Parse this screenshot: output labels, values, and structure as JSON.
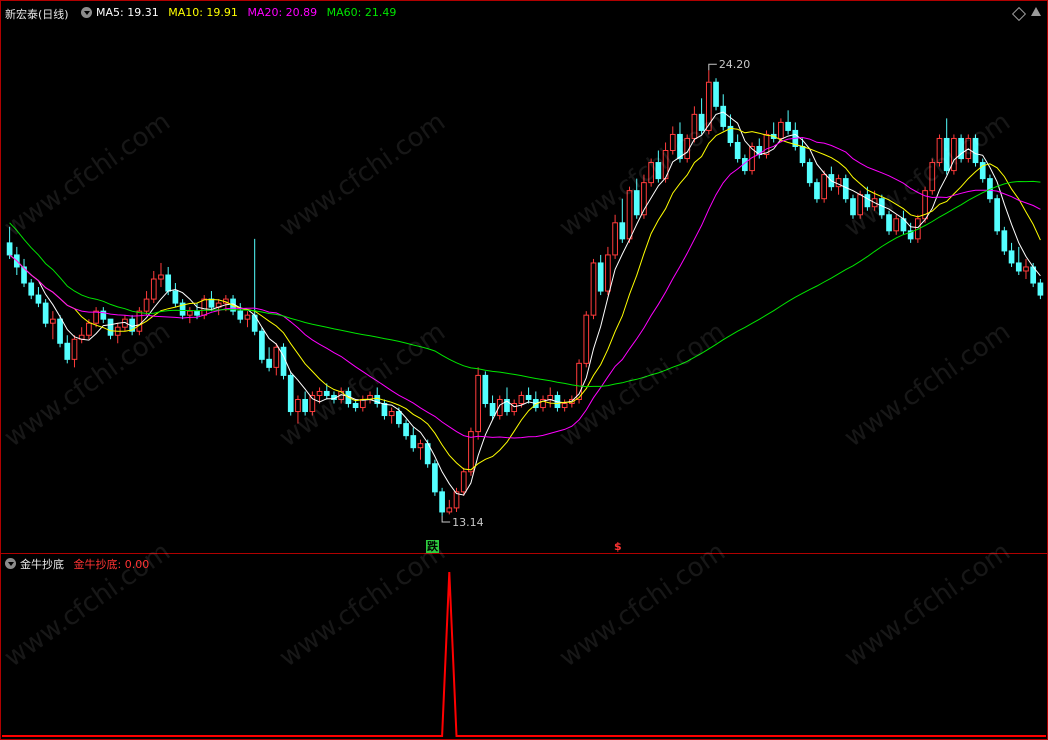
{
  "header": {
    "stock_title": "新宏泰(日线)",
    "ma5_label": "MA5: 19.31",
    "ma10_label": "MA10: 19.91",
    "ma20_label": "MA20: 20.89",
    "ma60_label": "MA60: 21.49"
  },
  "indicator_header": {
    "title": "金牛抄底",
    "value_label": "金牛抄底: 0.00"
  },
  "signals": {
    "down": "跌",
    "dollar": "$"
  },
  "annotations": {
    "high": "24.20",
    "low": "13.14"
  },
  "watermark": "www.cfchi.com",
  "colors": {
    "up": "#ff3c3c",
    "down": "#54ffff",
    "ma5": "#ffffff",
    "ma10": "#ffff00",
    "ma20": "#ff00ff",
    "ma60": "#00e600",
    "border": "#b00000",
    "indicator": "#ff0000"
  },
  "chart_data": [
    {
      "type": "candlestick",
      "title": "新宏泰(日线)",
      "ylim": [
        12.8,
        25.4
      ],
      "ohlc": [
        [
          19.9,
          20.3,
          19.5,
          19.6
        ],
        [
          19.6,
          19.8,
          19.1,
          19.3
        ],
        [
          19.3,
          19.5,
          18.8,
          18.9
        ],
        [
          18.9,
          19.0,
          18.5,
          18.6
        ],
        [
          18.6,
          18.8,
          18.3,
          18.4
        ],
        [
          18.4,
          18.5,
          17.8,
          17.9
        ],
        [
          17.9,
          18.2,
          17.5,
          18.0
        ],
        [
          18.0,
          18.1,
          17.3,
          17.4
        ],
        [
          17.4,
          17.6,
          16.9,
          17.0
        ],
        [
          17.0,
          17.6,
          16.8,
          17.5
        ],
        [
          17.5,
          17.8,
          17.4,
          17.6
        ],
        [
          17.6,
          18.0,
          17.5,
          17.9
        ],
        [
          17.9,
          18.3,
          17.8,
          18.2
        ],
        [
          18.2,
          18.3,
          17.9,
          18.0
        ],
        [
          18.0,
          18.0,
          17.5,
          17.6
        ],
        [
          17.6,
          17.9,
          17.4,
          17.8
        ],
        [
          17.8,
          18.1,
          17.7,
          18.0
        ],
        [
          18.0,
          18.1,
          17.6,
          17.7
        ],
        [
          17.7,
          18.3,
          17.6,
          18.2
        ],
        [
          18.2,
          18.7,
          18.1,
          18.5
        ],
        [
          18.5,
          19.2,
          18.4,
          19.0
        ],
        [
          19.0,
          19.4,
          18.8,
          19.1
        ],
        [
          19.1,
          19.3,
          18.6,
          18.7
        ],
        [
          18.7,
          18.9,
          18.3,
          18.4
        ],
        [
          18.4,
          18.5,
          18.0,
          18.1
        ],
        [
          18.1,
          18.3,
          17.9,
          18.2
        ],
        [
          18.2,
          18.4,
          18.0,
          18.1
        ],
        [
          18.1,
          18.6,
          18.0,
          18.5
        ],
        [
          18.5,
          18.7,
          18.2,
          18.3
        ],
        [
          18.3,
          18.5,
          18.1,
          18.4
        ],
        [
          18.4,
          18.6,
          18.2,
          18.5
        ],
        [
          18.5,
          18.6,
          18.1,
          18.2
        ],
        [
          18.2,
          18.4,
          17.9,
          18.0
        ],
        [
          18.0,
          18.2,
          17.8,
          18.1
        ],
        [
          18.1,
          20.0,
          17.6,
          17.7
        ],
        [
          17.7,
          17.8,
          16.9,
          17.0
        ],
        [
          17.0,
          17.3,
          16.7,
          16.8
        ],
        [
          16.8,
          17.4,
          16.6,
          17.3
        ],
        [
          17.3,
          17.4,
          16.5,
          16.6
        ],
        [
          16.6,
          16.7,
          15.6,
          15.7
        ],
        [
          15.7,
          16.1,
          15.4,
          16.0
        ],
        [
          16.0,
          16.2,
          15.6,
          15.7
        ],
        [
          15.7,
          16.2,
          15.6,
          16.1
        ],
        [
          16.1,
          16.3,
          15.9,
          16.2
        ],
        [
          16.2,
          16.4,
          16.0,
          16.1
        ],
        [
          16.1,
          16.2,
          15.9,
          16.0
        ],
        [
          16.0,
          16.3,
          15.9,
          16.2
        ],
        [
          16.2,
          16.3,
          15.8,
          15.9
        ],
        [
          15.9,
          16.0,
          15.7,
          15.8
        ],
        [
          15.8,
          16.1,
          15.7,
          16.0
        ],
        [
          16.0,
          16.2,
          15.9,
          16.1
        ],
        [
          16.1,
          16.3,
          15.8,
          15.9
        ],
        [
          15.9,
          16.0,
          15.5,
          15.6
        ],
        [
          15.6,
          15.8,
          15.4,
          15.7
        ],
        [
          15.7,
          15.8,
          15.3,
          15.4
        ],
        [
          15.4,
          15.5,
          15.0,
          15.1
        ],
        [
          15.1,
          15.3,
          14.7,
          14.8
        ],
        [
          14.8,
          15.0,
          14.5,
          14.9
        ],
        [
          14.9,
          15.0,
          14.3,
          14.4
        ],
        [
          14.4,
          14.5,
          13.6,
          13.7
        ],
        [
          13.7,
          13.8,
          13.1,
          13.2
        ],
        [
          13.2,
          13.5,
          13.14,
          13.3
        ],
        [
          13.3,
          13.8,
          13.2,
          13.7
        ],
        [
          13.7,
          14.3,
          13.6,
          14.2
        ],
        [
          14.2,
          15.3,
          14.1,
          15.2
        ],
        [
          15.2,
          16.8,
          15.0,
          16.6
        ],
        [
          16.6,
          16.7,
          15.8,
          15.9
        ],
        [
          15.9,
          16.1,
          15.5,
          15.6
        ],
        [
          15.6,
          16.1,
          15.5,
          16.0
        ],
        [
          16.0,
          16.3,
          15.6,
          15.7
        ],
        [
          15.7,
          16.0,
          15.6,
          15.9
        ],
        [
          15.9,
          16.2,
          15.8,
          16.1
        ],
        [
          16.1,
          16.3,
          15.9,
          16.0
        ],
        [
          16.0,
          16.2,
          15.7,
          15.8
        ],
        [
          15.8,
          16.1,
          15.7,
          16.0
        ],
        [
          16.0,
          16.3,
          15.8,
          16.1
        ],
        [
          16.1,
          16.2,
          15.7,
          15.8
        ],
        [
          15.8,
          16.0,
          15.7,
          15.9
        ],
        [
          15.9,
          16.1,
          15.8,
          16.0
        ],
        [
          16.0,
          17.0,
          15.9,
          16.9
        ],
        [
          16.9,
          18.2,
          16.8,
          18.1
        ],
        [
          18.1,
          19.5,
          18.0,
          19.4
        ],
        [
          19.4,
          19.6,
          18.6,
          18.7
        ],
        [
          18.7,
          19.8,
          18.6,
          19.6
        ],
        [
          19.6,
          20.6,
          19.5,
          20.4
        ],
        [
          20.4,
          21.0,
          19.9,
          20.0
        ],
        [
          20.0,
          21.3,
          19.9,
          21.2
        ],
        [
          21.2,
          21.5,
          20.5,
          20.6
        ],
        [
          20.6,
          21.6,
          20.5,
          21.4
        ],
        [
          21.4,
          22.0,
          21.3,
          21.9
        ],
        [
          21.9,
          22.2,
          21.4,
          21.5
        ],
        [
          21.5,
          22.4,
          21.4,
          22.2
        ],
        [
          22.2,
          22.8,
          22.1,
          22.6
        ],
        [
          22.6,
          22.9,
          21.9,
          22.0
        ],
        [
          22.0,
          22.6,
          21.9,
          22.5
        ],
        [
          22.5,
          23.3,
          22.4,
          23.1
        ],
        [
          23.1,
          23.5,
          22.6,
          22.7
        ],
        [
          22.7,
          24.2,
          22.6,
          23.9
        ],
        [
          23.9,
          24.0,
          23.2,
          23.3
        ],
        [
          23.3,
          23.6,
          22.7,
          22.8
        ],
        [
          22.8,
          23.1,
          22.3,
          22.4
        ],
        [
          22.4,
          22.6,
          21.9,
          22.0
        ],
        [
          22.0,
          22.1,
          21.6,
          21.7
        ],
        [
          21.7,
          22.4,
          21.6,
          22.3
        ],
        [
          22.3,
          22.5,
          22.0,
          22.1
        ],
        [
          22.1,
          22.7,
          22.0,
          22.6
        ],
        [
          22.6,
          22.9,
          22.4,
          22.5
        ],
        [
          22.5,
          23.0,
          22.4,
          22.9
        ],
        [
          22.9,
          23.2,
          22.6,
          22.7
        ],
        [
          22.7,
          22.9,
          22.2,
          22.3
        ],
        [
          22.3,
          22.5,
          21.8,
          21.9
        ],
        [
          21.9,
          22.0,
          21.3,
          21.4
        ],
        [
          21.4,
          21.5,
          20.9,
          21.0
        ],
        [
          21.0,
          21.7,
          20.9,
          21.6
        ],
        [
          21.6,
          21.8,
          21.2,
          21.3
        ],
        [
          21.3,
          21.6,
          21.1,
          21.5
        ],
        [
          21.5,
          21.6,
          20.9,
          21.0
        ],
        [
          21.0,
          21.1,
          20.5,
          20.6
        ],
        [
          20.6,
          21.2,
          20.5,
          21.1
        ],
        [
          21.1,
          21.3,
          20.7,
          20.8
        ],
        [
          20.8,
          21.2,
          20.7,
          21.0
        ],
        [
          21.0,
          21.1,
          20.5,
          20.6
        ],
        [
          20.6,
          20.7,
          20.1,
          20.2
        ],
        [
          20.2,
          20.6,
          20.1,
          20.5
        ],
        [
          20.5,
          20.7,
          20.1,
          20.2
        ],
        [
          20.2,
          20.4,
          19.9,
          20.0
        ],
        [
          20.0,
          20.6,
          19.9,
          20.5
        ],
        [
          20.5,
          21.3,
          20.4,
          21.2
        ],
        [
          21.2,
          22.0,
          21.1,
          21.9
        ],
        [
          21.9,
          22.6,
          21.8,
          22.5
        ],
        [
          22.5,
          23.0,
          21.6,
          21.7
        ],
        [
          21.7,
          22.6,
          21.6,
          22.5
        ],
        [
          22.5,
          22.6,
          21.9,
          22.0
        ],
        [
          22.0,
          22.6,
          21.9,
          22.5
        ],
        [
          22.5,
          22.6,
          21.8,
          21.9
        ],
        [
          21.9,
          22.0,
          21.4,
          21.5
        ],
        [
          21.5,
          21.6,
          20.9,
          21.0
        ],
        [
          21.0,
          21.1,
          20.1,
          20.2
        ],
        [
          20.2,
          20.3,
          19.6,
          19.7
        ],
        [
          19.7,
          19.9,
          19.3,
          19.4
        ],
        [
          19.4,
          19.8,
          19.1,
          19.2
        ],
        [
          19.2,
          19.5,
          19.0,
          19.3
        ],
        [
          19.3,
          19.4,
          18.8,
          18.9
        ],
        [
          18.9,
          19.0,
          18.5,
          18.6
        ]
      ],
      "ma_periods": [
        5,
        10,
        20,
        60
      ],
      "ma_latest": {
        "MA5": 19.31,
        "MA10": 19.91,
        "MA20": 20.89,
        "MA60": 21.49
      },
      "marked_high": 24.2,
      "marked_low": 13.14
    },
    {
      "type": "line",
      "title": "金牛抄底",
      "ylim": [
        0,
        1
      ],
      "spike_bar_index": 61,
      "spike_value": 1,
      "latest_value": 0.0
    }
  ]
}
